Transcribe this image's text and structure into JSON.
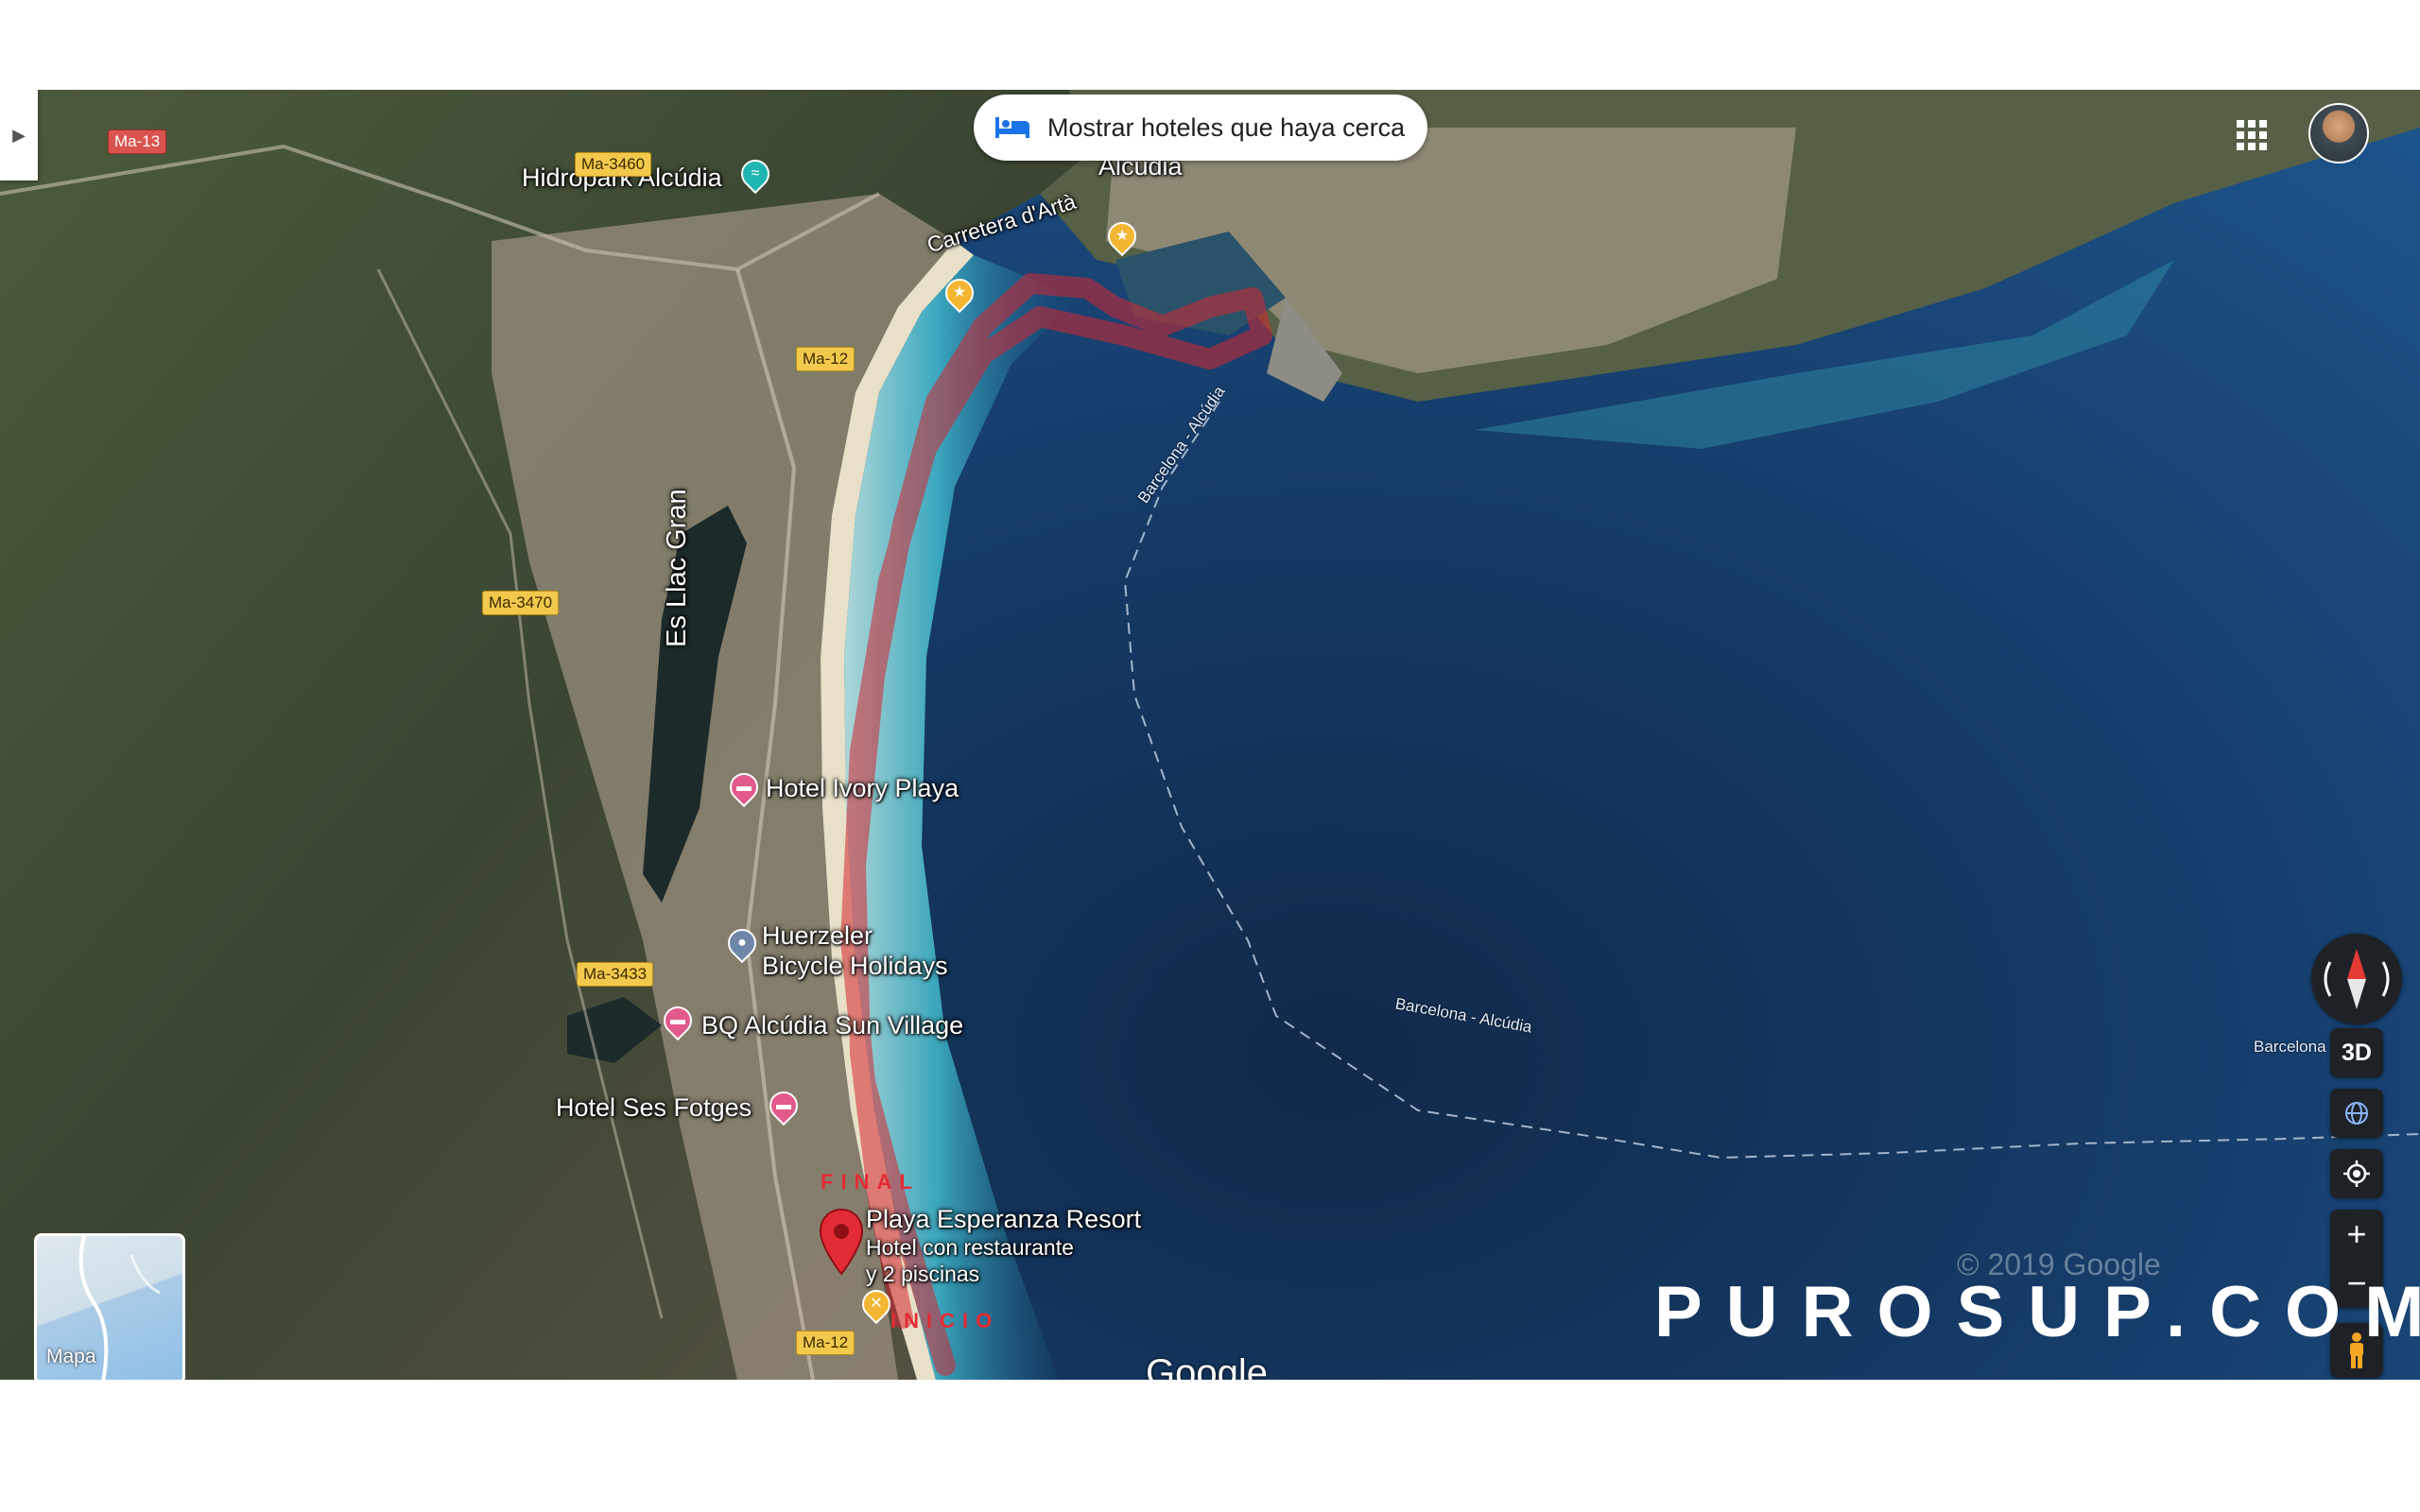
{
  "header": {
    "hotels_chip_label": "Mostrar hoteles que haya cerca"
  },
  "places": {
    "hidropark": "Hidropark Alcúdia",
    "alcudia": "Alcúdia",
    "es_llac_gran": "Es Llac Gran",
    "hotel_ivory": "Hotel Ivory Playa",
    "huerzeler_line1": "Huerzeler",
    "huerzeler_line2": "Bicycle Holidays",
    "bq_alcudia": "BQ Alcúdia Sun Village",
    "hotel_ses_fotges": "Hotel Ses Fotges",
    "playa_esperanza": "Playa Esperanza Resort",
    "playa_esperanza_sub1": "Hotel con restaurante",
    "playa_esperanza_sub2": "y 2 piscinas",
    "carretera_arta": "Carretera d'Artà"
  },
  "roads": {
    "ma13": "Ma-13",
    "ma3460": "Ma-3460",
    "ma12_top": "Ma-12",
    "ma3470": "Ma-3470",
    "ma3433": "Ma-3433",
    "ma12_bottom": "Ma-12"
  },
  "ferry": {
    "route1": "Barcelona - Alcúdia",
    "route2": "Barcelona - Alcúdia",
    "route3": "Barcelona -"
  },
  "route": {
    "end_label": "FINAL",
    "start_label": "INICIO"
  },
  "controls": {
    "view_3d": "3D",
    "zoom_in": "+",
    "zoom_out": "−",
    "minimap_label": "Mapa"
  },
  "attribution": {
    "google": "Google",
    "copyright": "© 2019 Google"
  },
  "watermark": "PUROSUP.COM",
  "colors": {
    "route": "#d3262f",
    "sea": "#153a66",
    "shallow": "#45b6c9",
    "land": "#3e4a34"
  },
  "icons": [
    "bed-icon",
    "apps-grid-icon",
    "compass-icon",
    "globe-icon",
    "my-location-icon",
    "pegman-icon",
    "chevron-right-icon"
  ]
}
